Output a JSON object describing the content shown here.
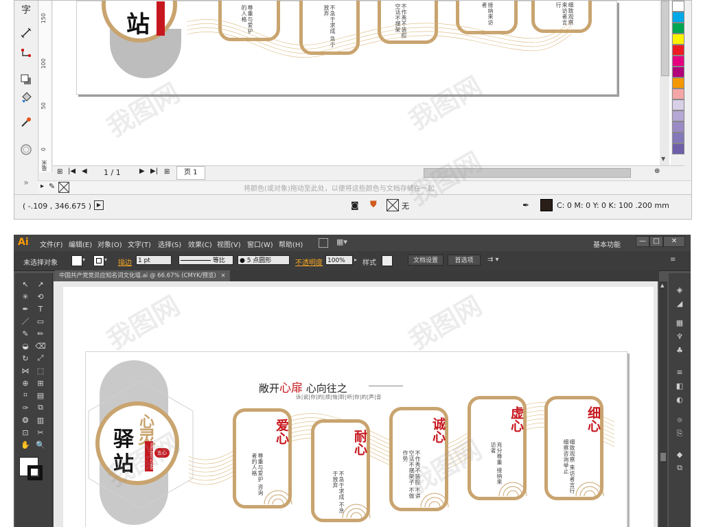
{
  "coreldraw": {
    "tools": [
      "text-tool",
      "dimension-tool",
      "connector-tool",
      "shadow-tool",
      "fill-tool",
      "eyedropper-tool",
      "lens-tool"
    ],
    "ruler_labels": [
      "150",
      "100",
      "50",
      "0"
    ],
    "ruler_unit": "毫米",
    "page_nav": {
      "counter": "1 / 1",
      "page_tab": "页 1"
    },
    "doc_hint": "将颜色(或对象)拖动至此处，以便将这些颜色与文档存储在一起",
    "status": {
      "coords": "( -.109 , 346.675 )",
      "fill_label": "无",
      "outline": "C: 0 M: 0 Y: 0 K: 100  .200 mm"
    },
    "palette_colors": [
      "#ffffff",
      "#00a8e8",
      "#00a651",
      "#fff200",
      "#ed1c24",
      "#e4007f",
      "#b2007a",
      "#f39800",
      "#f4a6a6",
      "#d8cfe8",
      "#b6a8d4",
      "#9b8ac4",
      "#8478bb",
      "#6f5fa8"
    ],
    "wall_preview": {
      "titles": [
        "爱",
        "耐",
        "诚",
        "虚",
        "细"
      ],
      "texts": [
        "尊重与爱护的人格",
        "不急于求成 急于放弃",
        "不作秀不装腔 空话不摆架",
        "接纳来访者",
        "细致观察 来访者言行"
      ]
    }
  },
  "illustrator": {
    "logo": "Ai",
    "menu": [
      "文件(F)",
      "编辑(E)",
      "对象(O)",
      "文字(T)",
      "选择(S)",
      "效果(C)",
      "视图(V)",
      "窗口(W)",
      "帮助(H)"
    ],
    "workspace": "基本功能",
    "window_buttons": [
      "—",
      "□",
      "✕"
    ],
    "control": {
      "selection": "未选择对象",
      "stroke_label": "描边",
      "stroke_value": "1 pt",
      "profile": "等比",
      "brush": "5 点圆形",
      "opacity_label": "不透明度",
      "opacity_value": "100%",
      "style_label": "样式",
      "doc_setup": "文档设置",
      "prefs": "首选项"
    },
    "tab": "中国共产党党员应知名词文化墙.ai @ 66.67% (CMYK/预览)",
    "tab_close": "×",
    "header": {
      "title_a": "敞开",
      "title_b": "心扉",
      "title_c": " 心向往之",
      "subtitle": "诉|说|你|的|烦|恼|聆|听|你|的|声|音"
    },
    "emblem": {
      "top": "心",
      "big1": "驿",
      "big2": "灵",
      "big3": "站",
      "pinyin": "XINLINGYIZHAN",
      "badge": "五心"
    },
    "cards": [
      {
        "title": "爱心",
        "text": "尊重与爱护 咨询者的人格"
      },
      {
        "title": "耐心",
        "text": "不急于求成 不急于放弃"
      },
      {
        "title": "诚心",
        "text": "不作秀不装腔 不讲空话不摆架子 不做作势"
      },
      {
        "title": "虚心",
        "text": "充分尊重 接纳来访者"
      },
      {
        "title": "细心",
        "text": "细致观察 来访者言行 细察咨询举止"
      }
    ]
  },
  "watermark": "我图网"
}
